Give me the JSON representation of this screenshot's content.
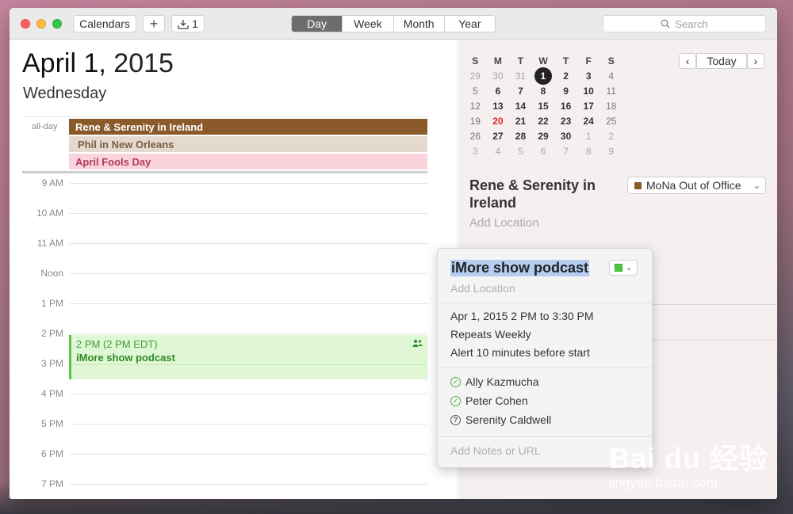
{
  "toolbar": {
    "calendars_label": "Calendars",
    "add_label": "+",
    "inbox_icon": "inbox-tray-icon",
    "inbox_count": "1",
    "views": [
      "Day",
      "Week",
      "Month",
      "Year"
    ],
    "active_view": "Day",
    "search_placeholder": "Search"
  },
  "day": {
    "month_day": "April 1,",
    "year": "2015",
    "weekday": "Wednesday",
    "allday_label": "all-day",
    "allday_events": [
      {
        "title": "Rene & Serenity in Ireland",
        "color": "#8b5a2b"
      },
      {
        "title": "Phil in New Orleans",
        "color": "#e3d9cf"
      },
      {
        "title": "April Fools Day",
        "color": "#fad3dd"
      }
    ],
    "hours": [
      "9 AM",
      "10 AM",
      "11 AM",
      "Noon",
      "1 PM",
      "2 PM",
      "3 PM",
      "4 PM",
      "5 PM",
      "6 PM",
      "7 PM"
    ],
    "event": {
      "time": "2 PM (2 PM EDT)",
      "title": "iMore show podcast",
      "color": "#5cc24a"
    }
  },
  "mini_calendar": {
    "weekdays": [
      "S",
      "M",
      "T",
      "W",
      "T",
      "F",
      "S"
    ],
    "weeks": [
      [
        "29",
        "30",
        "31",
        "1",
        "2",
        "3",
        "4"
      ],
      [
        "5",
        "6",
        "7",
        "8",
        "9",
        "10",
        "11"
      ],
      [
        "12",
        "13",
        "14",
        "15",
        "16",
        "17",
        "18"
      ],
      [
        "19",
        "20",
        "21",
        "22",
        "23",
        "24",
        "25"
      ],
      [
        "26",
        "27",
        "28",
        "29",
        "30",
        "1",
        "2"
      ],
      [
        "3",
        "4",
        "5",
        "6",
        "7",
        "8",
        "9"
      ]
    ],
    "today_label": "Today",
    "prev_label": "‹",
    "next_label": "›"
  },
  "detail": {
    "title": "Rene & Serenity in Ireland",
    "location_placeholder": "Add Location",
    "calendar_name": "MoNa Out of Office",
    "calendar_color": "#8b5a2b"
  },
  "popover": {
    "title": "iMore show podcast",
    "location_placeholder": "Add Location",
    "when": "Apr 1, 2015  2 PM to 3:30 PM",
    "repeats": "Repeats Weekly",
    "alert": "Alert 10 minutes before start",
    "invitees": [
      {
        "name": "Ally Kazmucha",
        "status": "accepted"
      },
      {
        "name": "Peter Cohen",
        "status": "accepted"
      },
      {
        "name": "Serenity Caldwell",
        "status": "pending"
      }
    ],
    "notes_placeholder": "Add Notes or URL",
    "color": "#4ec73d"
  },
  "watermark": {
    "text": "Bai du 经验",
    "url": "jingyan.baidu.com"
  }
}
